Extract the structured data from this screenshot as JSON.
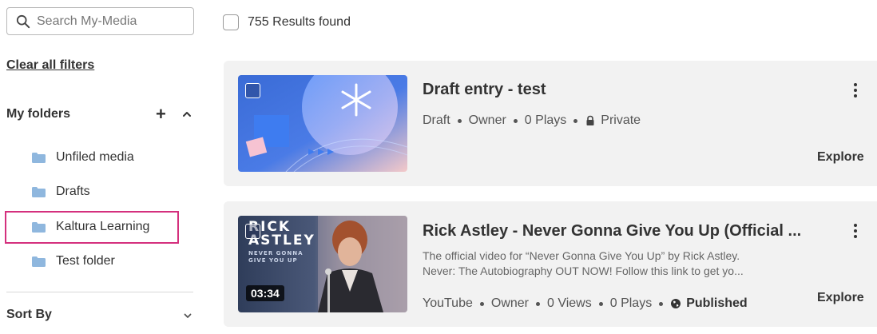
{
  "search": {
    "placeholder": "Search My-Media",
    "icon": "search-icon"
  },
  "filters": {
    "clear_label": "Clear all filters"
  },
  "folders": {
    "title": "My folders",
    "add_symbol": "+",
    "items": [
      {
        "label": "Unfiled media",
        "highlighted": false
      },
      {
        "label": "Drafts",
        "highlighted": false
      },
      {
        "label": "Kaltura Learning",
        "highlighted": true
      },
      {
        "label": "Test folder",
        "highlighted": false
      }
    ],
    "highlight_color": "#d4307d",
    "folder_icon_color": "#8fb7de"
  },
  "sort": {
    "label": "Sort By"
  },
  "results": {
    "text": "755 Results found"
  },
  "entries": [
    {
      "title": "Draft entry - test",
      "meta": [
        "Draft",
        "Owner",
        "0 Plays"
      ],
      "status": "Private",
      "status_icon": "lock-icon",
      "action": "Explore"
    },
    {
      "title": "Rick Astley - Never Gonna Give You Up (Official ...",
      "description_line1": "The official video for “Never Gonna Give You Up” by Rick Astley.",
      "description_line2": "Never: The Autobiography OUT NOW! Follow this link to get yo...",
      "meta": [
        "YouTube",
        "Owner",
        "0 Views",
        "0 Plays"
      ],
      "status": "Published",
      "status_icon": "globe-icon",
      "duration": "03:34",
      "thumb_text_line1": "RICK",
      "thumb_text_line2": "ASTLEY",
      "thumb_text_line3": "NEVER GONNA",
      "thumb_text_line4": "GIVE YOU UP",
      "action": "Explore"
    }
  ]
}
